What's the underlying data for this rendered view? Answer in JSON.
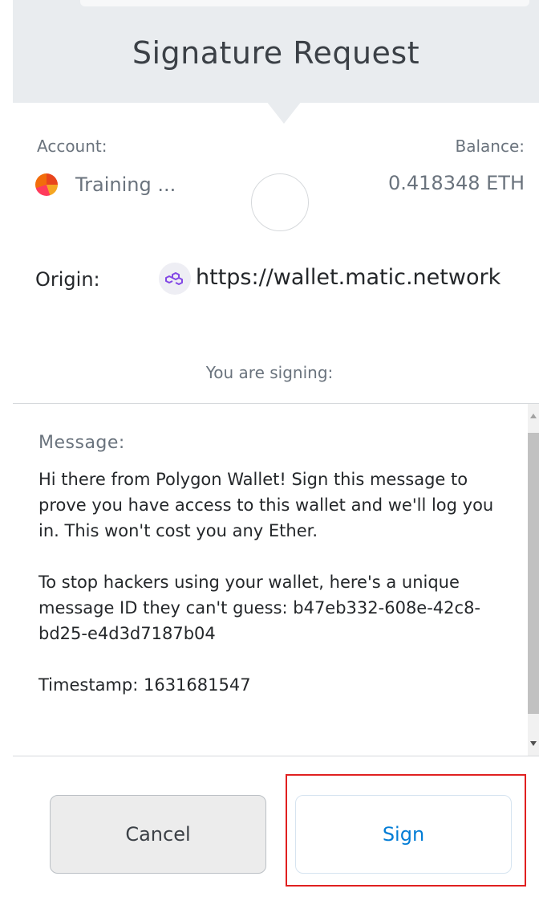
{
  "header": {
    "title": "Signature Request"
  },
  "account": {
    "label": "Account:",
    "name": "Training ..."
  },
  "balance": {
    "label": "Balance:",
    "value": "0.418348 ETH"
  },
  "origin": {
    "label": "Origin:",
    "url": "https://wallet.matic.network",
    "icon": "polygon-icon"
  },
  "signing": {
    "label": "You are signing:"
  },
  "message": {
    "label": "Message:",
    "body": "Hi there from Polygon Wallet! Sign this message to prove you have access to this wallet and we'll log you in. This won't cost you any Ether.\n\nTo stop hackers using your wallet, here's a unique message ID they can't guess: b47eb332-608e-42c8-bd25-e4d3d7187b04\n\nTimestamp: 1631681547"
  },
  "buttons": {
    "cancel": "Cancel",
    "sign": "Sign"
  },
  "colors": {
    "accent": "#037dd6",
    "highlight": "#e02020",
    "polygon": "#8247e5"
  }
}
